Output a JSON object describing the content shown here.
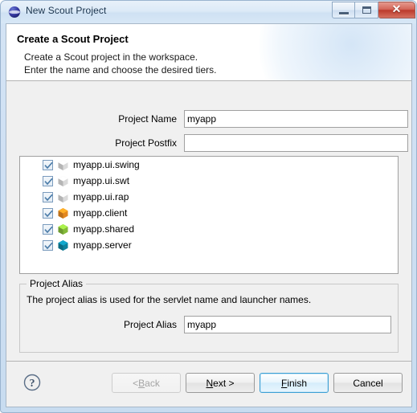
{
  "window": {
    "title": "New Scout Project",
    "icon": "eclipse-sphere-icon",
    "controls": {
      "minimize": "minimize-icon",
      "maximize": "restore-icon",
      "close": "✕"
    }
  },
  "header": {
    "title": "Create a Scout Project",
    "description_line1": "Create a Scout project in the workspace.",
    "description_line2": "Enter the name and choose the desired tiers."
  },
  "form": {
    "project_name": {
      "label": "Project Name",
      "value": "myapp",
      "placeholder": ""
    },
    "project_postfix": {
      "label": "Project Postfix",
      "value": "",
      "placeholder": ""
    }
  },
  "tiers": [
    {
      "label": "myapp.ui.swing",
      "checked": true,
      "icon": "hexagon-icon",
      "color": "#e8e8e8"
    },
    {
      "label": "myapp.ui.swt",
      "checked": true,
      "icon": "hexagon-icon",
      "color": "#e8e8e8"
    },
    {
      "label": "myapp.ui.rap",
      "checked": true,
      "icon": "hexagon-icon",
      "color": "#e8e8e8"
    },
    {
      "label": "myapp.client",
      "checked": true,
      "icon": "hexagon-icon",
      "color": "#f29021"
    },
    {
      "label": "myapp.shared",
      "checked": true,
      "icon": "hexagon-icon",
      "color": "#8cc63e"
    },
    {
      "label": "myapp.server",
      "checked": true,
      "icon": "hexagon-icon",
      "color": "#0e8aa8"
    }
  ],
  "alias_group": {
    "title": "Project Alias",
    "description": "The project alias is used for the servlet name and launcher names.",
    "field": {
      "label": "Project Alias",
      "value": "myapp",
      "placeholder": ""
    }
  },
  "footer": {
    "help_icon": "question-mark-icon",
    "buttons": [
      {
        "label": "< Back",
        "name": "back-button",
        "state": "disabled"
      },
      {
        "label": "Next >",
        "name": "next-button",
        "state": "enabled",
        "mnemonic": "N"
      },
      {
        "label": "Finish",
        "name": "finish-button",
        "state": "default",
        "mnemonic": "F"
      },
      {
        "label": "Cancel",
        "name": "cancel-button",
        "state": "enabled"
      }
    ]
  },
  "colors": {
    "accent": "#3c9fd4",
    "window_frame": "#cfe0f3",
    "dialog_bg": "#f0f0f0"
  }
}
